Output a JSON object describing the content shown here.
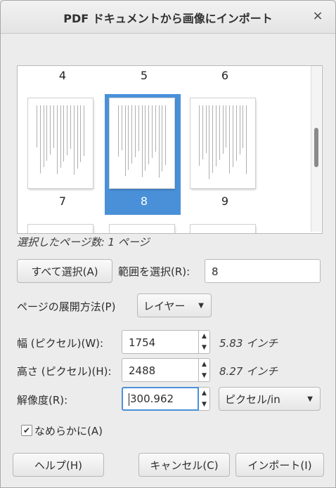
{
  "window": {
    "title": "PDF ドキュメントから画像にインポート",
    "close_glyph": "×"
  },
  "thumbnails": {
    "rows": [
      {
        "numbers": [
          "4",
          "5",
          "6"
        ]
      },
      {
        "numbers": [
          "7",
          "8",
          "9"
        ]
      }
    ],
    "selected_page": "8",
    "selection_color": "#4a90d9"
  },
  "selection": {
    "count_text": "選択したページ数: 1 ページ",
    "select_all_label": "すべて選択(A)",
    "range_label": "範囲を選択(R):",
    "range_value": "8"
  },
  "open_pages_as": {
    "label": "ページの展開方法(P)",
    "value": "レイヤー"
  },
  "width": {
    "label": "幅 (ピクセル)(W):",
    "value": "1754",
    "inches": "5.83 インチ"
  },
  "height": {
    "label": "高さ (ピクセル)(H):",
    "value": "2488",
    "inches": "8.27 インチ"
  },
  "resolution": {
    "label": "解像度(R):",
    "value": "300.962",
    "unit": "ピクセル/in"
  },
  "antialias": {
    "label": "なめらかに(A)",
    "checked": true
  },
  "buttons": {
    "help": "ヘルプ(H)",
    "cancel": "キャンセル(C)",
    "import": "インポート(I)"
  }
}
